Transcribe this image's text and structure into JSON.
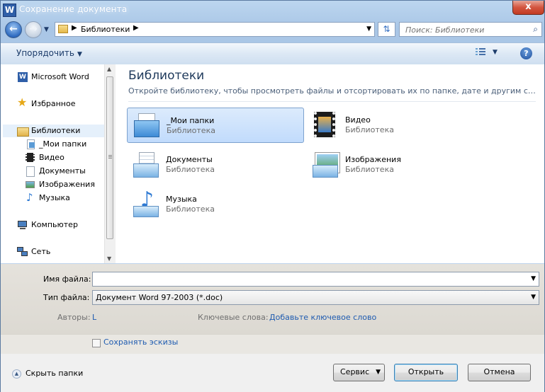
{
  "window": {
    "title": "Сохранение документа",
    "app_icon_letter": "W",
    "close_label": "x"
  },
  "address": {
    "crumb": "Библиотеки",
    "search_placeholder": "Поиск: Библиотеки"
  },
  "toolbar": {
    "organize_label": "Упорядочить",
    "help_label": "?"
  },
  "nav": {
    "items": [
      {
        "label": "Microsoft Word",
        "icon": "word-icon"
      },
      {
        "label": "Избранное",
        "icon": "star-icon"
      },
      {
        "label": "Библиотеки",
        "icon": "libraries-icon",
        "selected": true
      },
      {
        "label": "_Мои папки",
        "icon": "folder-library-icon"
      },
      {
        "label": "Видео",
        "icon": "video-icon"
      },
      {
        "label": "Документы",
        "icon": "documents-icon"
      },
      {
        "label": "Изображения",
        "icon": "pictures-icon"
      },
      {
        "label": "Музыка",
        "icon": "music-icon"
      },
      {
        "label": "Компьютер",
        "icon": "computer-icon"
      },
      {
        "label": "Сеть",
        "icon": "network-icon"
      }
    ]
  },
  "content": {
    "title": "Библиотеки",
    "subtitle": "Откройте библиотеку, чтобы просмотреть файлы и отсортировать их по папке, дате и другим сво...",
    "libraries": [
      {
        "name": "_Мои папки",
        "type": "Библиотека",
        "icon": "folder-library-icon",
        "selected": true
      },
      {
        "name": "Видео",
        "type": "Библиотека",
        "icon": "video-library-icon"
      },
      {
        "name": "Документы",
        "type": "Библиотека",
        "icon": "documents-library-icon"
      },
      {
        "name": "Изображения",
        "type": "Библиотека",
        "icon": "pictures-library-icon"
      },
      {
        "name": "Музыка",
        "type": "Библиотека",
        "icon": "music-library-icon"
      }
    ]
  },
  "form": {
    "filename_label": "Имя файла:",
    "filename_value": "",
    "filetype_label": "Тип файла:",
    "filetype_value": "Документ Word 97-2003 (*.doc)",
    "authors_label": "Авторы:",
    "authors_value": "L",
    "keywords_label": "Ключевые слова:",
    "keywords_value": "Добавьте ключевое слово",
    "thumbnails_label": "Сохранять эскизы",
    "thumbnails_checked": false
  },
  "footer": {
    "hide_folders_label": "Скрыть папки",
    "tools_label": "Сервис",
    "open_label": "Открыть",
    "cancel_label": "Отмена"
  },
  "colors": {
    "accent": "#1e5bb0",
    "title_text": "#1e395b",
    "selection": "#c1dbfc"
  }
}
